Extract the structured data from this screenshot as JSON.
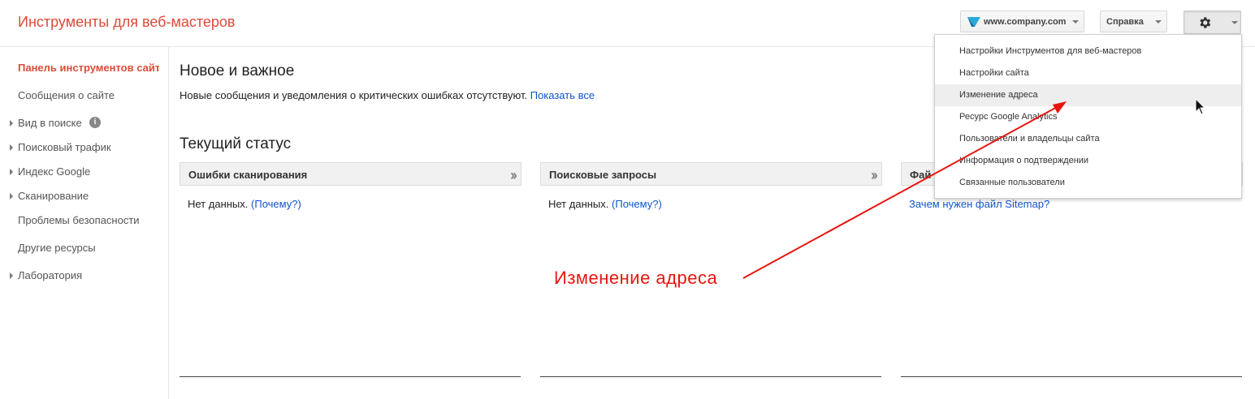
{
  "header": {
    "app_title": "Инструменты для веб-мастеров",
    "site_selector": "www.company.com",
    "help_label": "Справка",
    "settings_icon": "gear-icon"
  },
  "sidebar": {
    "items": [
      {
        "label": "Панель инструментов сайта",
        "active": true,
        "expandable": false
      },
      {
        "label": "Сообщения о сайте",
        "active": false,
        "expandable": false
      },
      {
        "label": "Вид в поиске",
        "active": false,
        "expandable": true,
        "info_icon": "i"
      },
      {
        "label": "Поисковый трафик",
        "active": false,
        "expandable": true
      },
      {
        "label": "Индекс Google",
        "active": false,
        "expandable": true
      },
      {
        "label": "Сканирование",
        "active": false,
        "expandable": true
      },
      {
        "label": "Проблемы безопасности",
        "active": false,
        "expandable": false
      },
      {
        "label": "Другие ресурсы",
        "active": false,
        "expandable": false
      },
      {
        "label": "Лаборатория",
        "active": false,
        "expandable": true
      }
    ]
  },
  "main": {
    "news_title": "Новое и важное",
    "news_message": "Новые сообщения и уведомления о критических ошибках отсутствуют.",
    "news_link": "Показать все",
    "status_title": "Текущий статус",
    "panels": [
      {
        "title": "Ошибки сканирования",
        "text": "Нет данных.",
        "link": "(Почему?)"
      },
      {
        "title": "Поисковые запросы",
        "text": "Нет данных.",
        "link": "(Почему?)"
      },
      {
        "title": "Фай",
        "text": "",
        "link": "Зачем нужен файл Sitemap?"
      }
    ]
  },
  "menu": {
    "items": [
      {
        "label": "Настройки Инструментов для веб-мастеров"
      },
      {
        "label": "Настройки сайта"
      },
      {
        "label": "Изменение адреса",
        "hovered": true
      },
      {
        "label": "Ресурс Google Analytics"
      },
      {
        "label": "Пользователи и владельцы сайта"
      },
      {
        "label": "Информация о подтверждении"
      },
      {
        "label": "Связанные пользователи"
      }
    ]
  },
  "annotation": {
    "text": "Изменение адреса",
    "color": "#e8150f"
  },
  "colors": {
    "brand_red": "#dd4b39",
    "link_blue": "#1155cc"
  }
}
